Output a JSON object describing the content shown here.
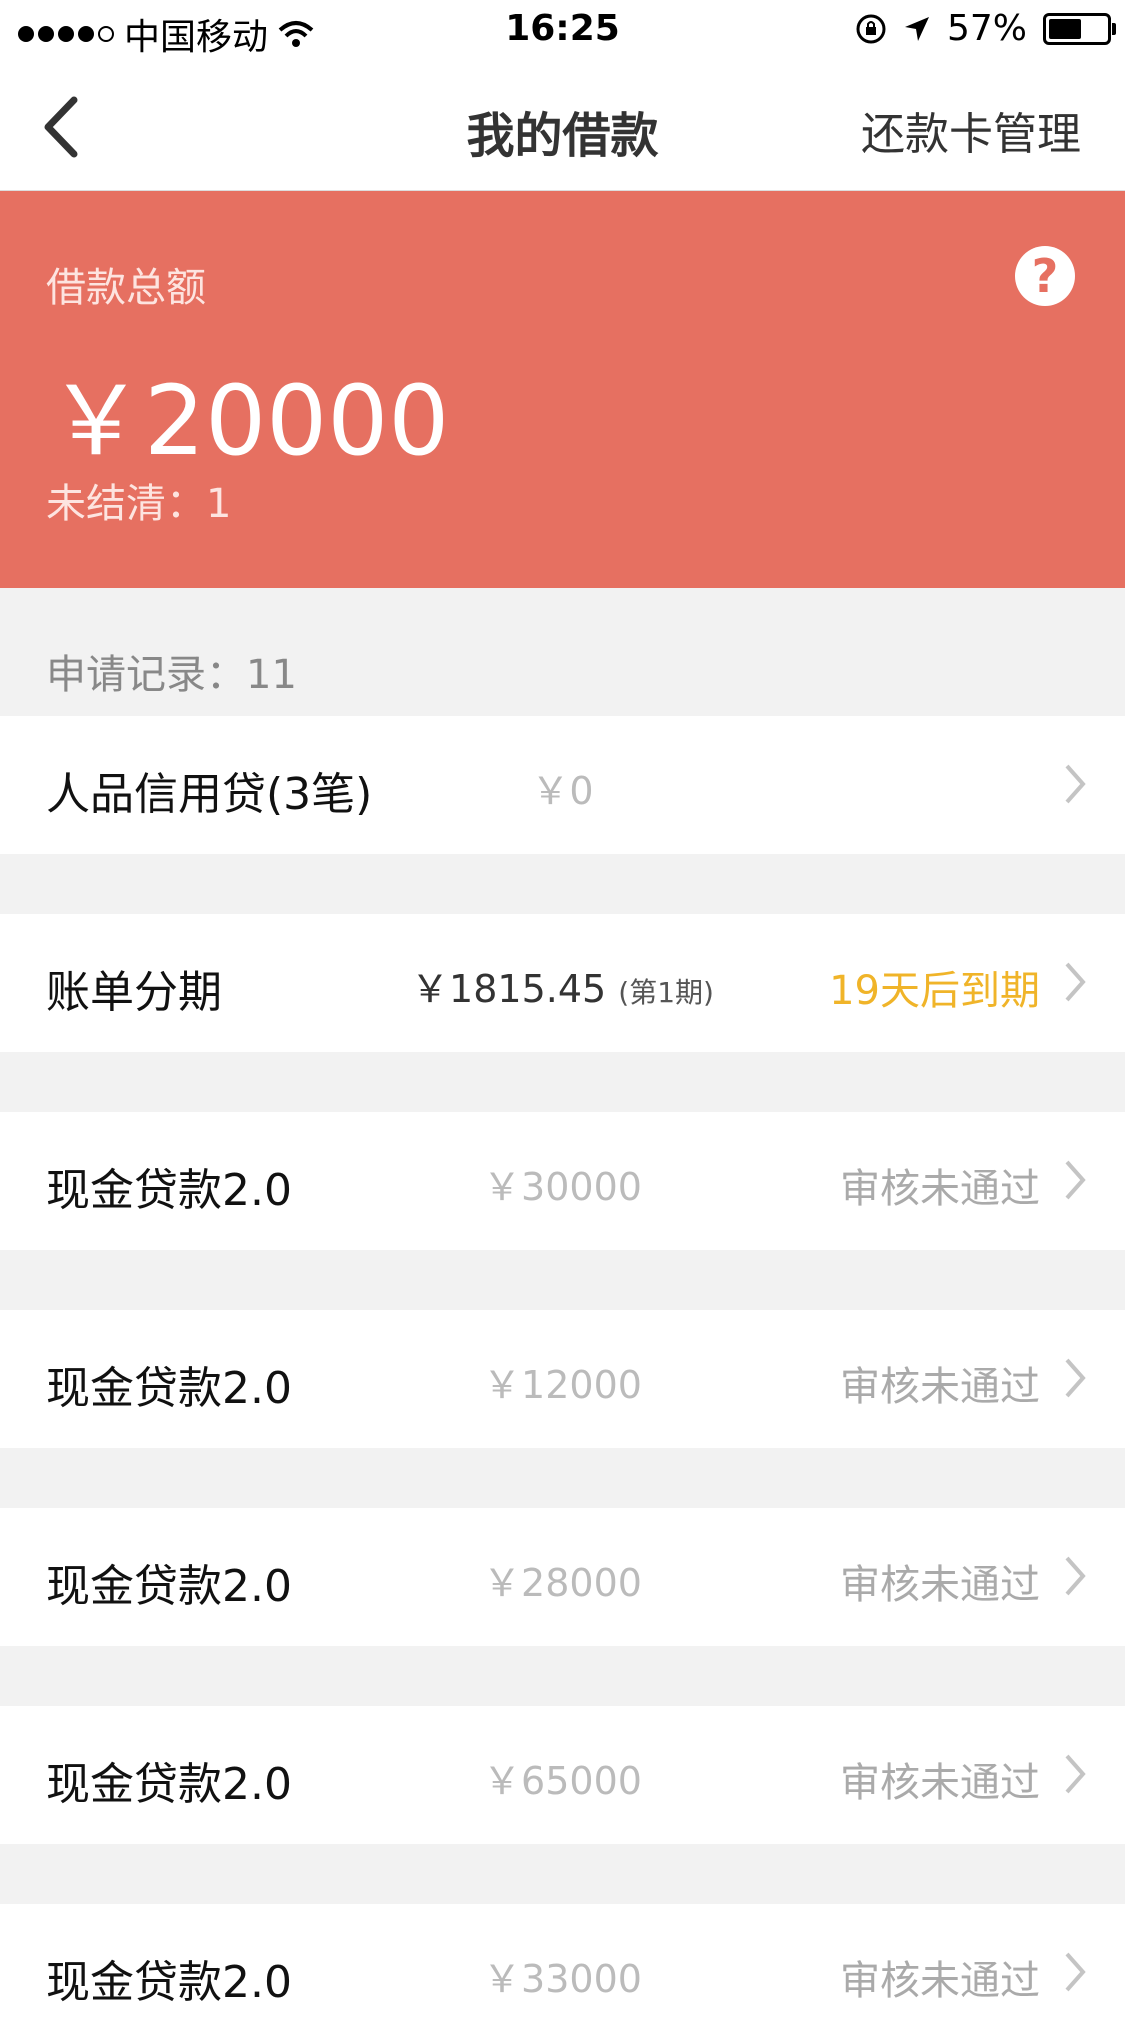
{
  "status_bar": {
    "carrier": "中国移动",
    "time": "16:25",
    "battery": "57%",
    "battery_level": 0.57
  },
  "nav": {
    "title": "我的借款",
    "right_action": "还款卡管理"
  },
  "summary": {
    "label": "借款总额",
    "amount": "￥20000",
    "outstanding": "未结清：1",
    "help_icon": "?"
  },
  "records_label": "申请记录：11",
  "loans": [
    {
      "name": "人品信用贷(3笔)",
      "amount": "￥0",
      "period": "",
      "status": ""
    },
    {
      "name": "账单分期",
      "amount": "￥1815.45",
      "period": "(第1期)",
      "status": "19天后到期"
    },
    {
      "name": "现金贷款2.0",
      "amount": "￥30000",
      "period": "",
      "status": "审核未通过"
    },
    {
      "name": "现金贷款2.0",
      "amount": "￥12000",
      "period": "",
      "status": "审核未通过"
    },
    {
      "name": "现金贷款2.0",
      "amount": "￥28000",
      "period": "",
      "status": "审核未通过"
    },
    {
      "name": "现金贷款2.0",
      "amount": "￥65000",
      "period": "",
      "status": "审核未通过"
    },
    {
      "name": "现金贷款2.0",
      "amount": "￥33000",
      "period": "",
      "status": "审核未通过"
    }
  ],
  "colors": {
    "hero": "#e67061",
    "due": "#f0b429"
  }
}
